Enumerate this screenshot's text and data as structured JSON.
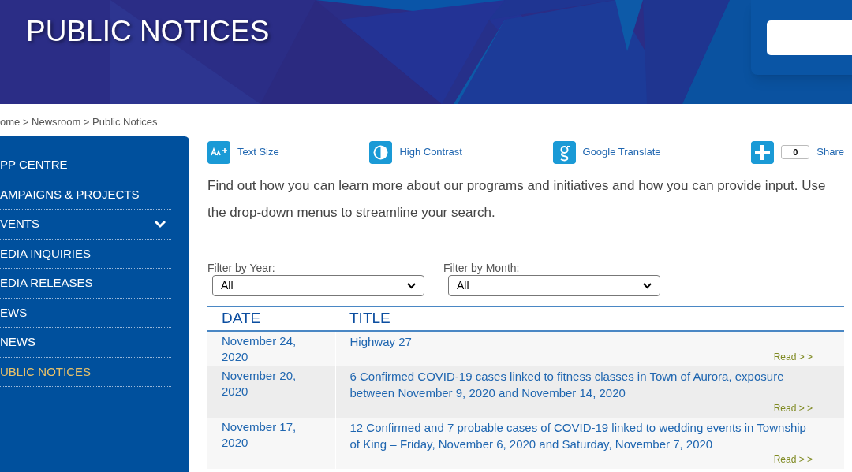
{
  "header": {
    "title": "PUBLIC NOTICES"
  },
  "breadcrumb": "ome > Newsroom > Public Notices",
  "sidebar": {
    "items": [
      {
        "label": "PP CENTRE",
        "selected": false,
        "expandable": false
      },
      {
        "label": "AMPAIGNS & PROJECTS",
        "selected": false,
        "expandable": false
      },
      {
        "label": "VENTS",
        "selected": false,
        "expandable": true
      },
      {
        "label": "EDIA INQUIRIES",
        "selected": false,
        "expandable": false
      },
      {
        "label": "EDIA RELEASES",
        "selected": false,
        "expandable": false
      },
      {
        "label": "EWS",
        "selected": false,
        "expandable": false
      },
      {
        "label": "NEWS",
        "selected": false,
        "expandable": false
      },
      {
        "label": "UBLIC NOTICES",
        "selected": true,
        "expandable": false
      }
    ]
  },
  "tools": [
    {
      "kind": "textsize",
      "label": "Text Size"
    },
    {
      "kind": "contrast",
      "label": "High Contrast"
    },
    {
      "kind": "translate",
      "label": "Google Translate"
    },
    {
      "kind": "share",
      "label": "Share",
      "count": "0"
    }
  ],
  "intro": "Find out how you can learn more about our programs and initiatives and how you can provide input. Use the drop-down menus to streamline your search.",
  "filters": [
    {
      "label": "Filter by Year:",
      "value": "All"
    },
    {
      "label": "Filter by Month:",
      "value": "All"
    }
  ],
  "table": {
    "columns": [
      "DATE",
      "TITLE"
    ],
    "rows": [
      {
        "date": "November 24, 2020",
        "title": "Highway 27",
        "link": "Read > >"
      },
      {
        "date": "November 20, 2020",
        "title": "6 Confirmed COVID-19 cases linked to fitness classes in Town of Aurora, exposure between November 9, 2020 and November 14, 2020",
        "link": "Read > >"
      },
      {
        "date": "November 17, 2020",
        "title": "12 Confirmed and 7 probable cases of COVID-19 linked to wedding events in Township of King – Friday, November 6, 2020 and Saturday, November 7, 2020",
        "link": "Read > >"
      }
    ]
  }
}
